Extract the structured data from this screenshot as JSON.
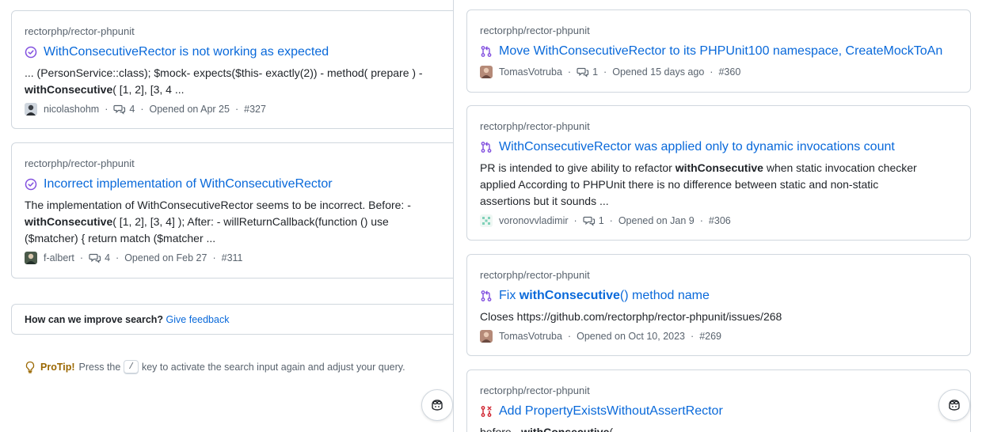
{
  "left": {
    "results": [
      {
        "repo": "rectorphp/rector-phpunit",
        "title": "WithConsecutiveRector is not working as expected",
        "snippet_lines": [
          [
            {
              "t": "... (PersonService::class); $mock- expects($this- exactly(2)) - method( prepare ) -",
              "b": false
            }
          ],
          [
            {
              "t": "withConsecutive",
              "b": true
            },
            {
              "t": "( [1, 2], [3, 4 ...",
              "b": false
            }
          ]
        ],
        "author": "nicolashohm",
        "comments": "4",
        "opened": "Opened on Apr 25",
        "number": "#327"
      },
      {
        "repo": "rectorphp/rector-phpunit",
        "title": "Incorrect implementation of WithConsecutiveRector",
        "snippet_lines": [
          [
            {
              "t": "The implementation of WithConsecutiveRector seems to be incorrect. Before: -",
              "b": false
            }
          ],
          [
            {
              "t": "withConsecutive",
              "b": true
            },
            {
              "t": "( [1, 2], [3, 4] ); After: - willReturnCallback(function () use",
              "b": false
            }
          ],
          [
            {
              "t": "($matcher) { return match ($matcher ...",
              "b": false
            }
          ]
        ],
        "author": "f-albert",
        "comments": "4",
        "opened": "Opened on Feb 27",
        "number": "#311"
      }
    ],
    "feedback": {
      "question": "How can we improve search?",
      "link": "Give feedback"
    },
    "protip": {
      "label": "ProTip!",
      "before": "Press the",
      "key": "/",
      "after": "key to activate the search input again and adjust your query."
    }
  },
  "right": {
    "results": [
      {
        "repo": "rectorphp/rector-phpunit",
        "title_parts": [
          {
            "t": "Move WithConsecutiveRector to its PHPUnit100 namespace, CreateMockToAn",
            "b": false
          }
        ],
        "snippet_lines": [],
        "author": "TomasVotruba",
        "comments": "1",
        "opened": "Opened 15 days ago",
        "number": "#360",
        "state": "open"
      },
      {
        "repo": "rectorphp/rector-phpunit",
        "title_parts": [
          {
            "t": "WithConsecutiveRector was applied only to dynamic invocations count",
            "b": false
          }
        ],
        "snippet_lines": [
          [
            {
              "t": "PR is intended to give ability to refactor ",
              "b": false
            },
            {
              "t": "withConsecutive",
              "b": true
            },
            {
              "t": " when static invocation checker",
              "b": false
            }
          ],
          [
            {
              "t": "applied According to PHPUnit there is no difference between static and non-static",
              "b": false
            }
          ],
          [
            {
              "t": "assertions but it sounds ...",
              "b": false
            }
          ]
        ],
        "author": "voronovvladimir",
        "comments": "1",
        "opened": "Opened on Jan 9",
        "number": "#306",
        "state": "open"
      },
      {
        "repo": "rectorphp/rector-phpunit",
        "title_parts": [
          {
            "t": "Fix ",
            "b": false
          },
          {
            "t": "withConsecutive",
            "b": true
          },
          {
            "t": "() method name",
            "b": false
          }
        ],
        "snippet_lines": [
          [
            {
              "t": "Closes https://github.com/rectorphp/rector-phpunit/issues/268",
              "b": false
            }
          ]
        ],
        "author": "TomasVotruba",
        "comments": "",
        "opened": "Opened on Oct 10, 2023",
        "number": "#269",
        "state": "open"
      },
      {
        "repo": "rectorphp/rector-phpunit",
        "title_parts": [
          {
            "t": "Add PropertyExistsWithoutAssertRector",
            "b": false
          }
        ],
        "snippet_lines": [
          [
            {
              "t": "before - ",
              "b": false
            },
            {
              "t": "withConsecutive",
              "b": true
            },
            {
              "t": "(",
              "b": false
            }
          ]
        ],
        "author": "",
        "comments": "",
        "opened": "",
        "number": "",
        "state": "closed"
      }
    ]
  },
  "colors": {
    "link": "#0969da",
    "muted": "#59636e",
    "issue_closed": "#8250df",
    "pr_open": "#8250df",
    "pr_closed": "#cf222e",
    "border": "#d0d7de",
    "protip": "#9a6700"
  },
  "icons": {
    "issue": "issue-closed-icon",
    "pr": "pull-request-icon",
    "comment": "comment-icon",
    "bulb": "light-bulb-icon",
    "copilot": "copilot-icon"
  }
}
